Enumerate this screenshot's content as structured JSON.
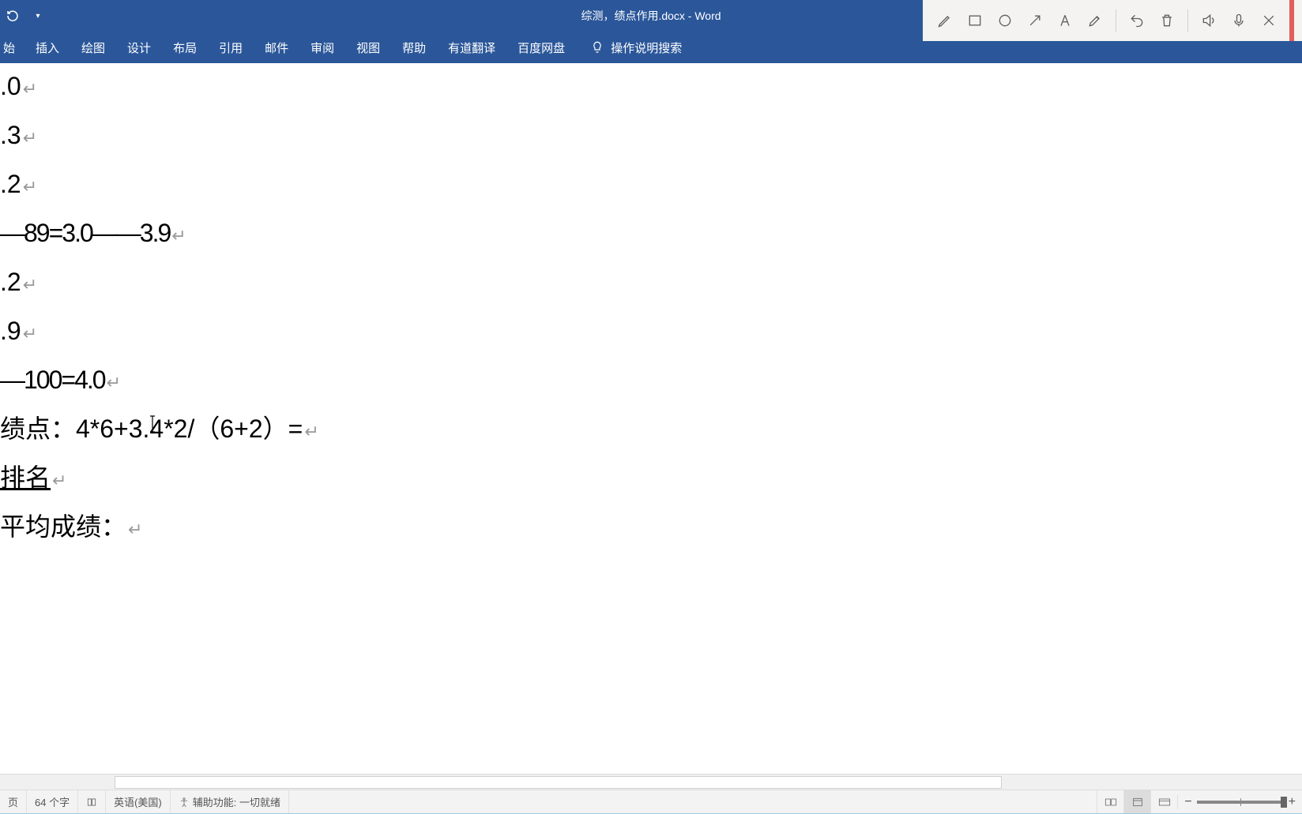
{
  "titlebar": {
    "doc_title": "综测，绩点作用.docx - Word"
  },
  "ribbon": {
    "tabs": [
      "始",
      "插入",
      "绘图",
      "设计",
      "布局",
      "引用",
      "邮件",
      "审阅",
      "视图",
      "帮助",
      "有道翻译",
      "百度网盘"
    ],
    "tell_me": "操作说明搜索"
  },
  "document": {
    "lines": [
      ".0",
      ".3",
      ".2",
      "—89=3.0——3.9",
      ".2",
      ".9",
      "—100=4.0",
      "绩点：4*6+3.4*2/（6+2）=",
      "排名",
      "平均成绩： "
    ]
  },
  "statusbar": {
    "page": "页",
    "words": "64 个字",
    "language": "英语(美国)",
    "accessibility": "辅助功能: 一切就绪"
  },
  "rec_toolbar": {
    "tools": [
      "pen",
      "square",
      "circle",
      "arrow",
      "text",
      "highlighter",
      "undo",
      "delete",
      "sound",
      "mic",
      "close"
    ]
  }
}
